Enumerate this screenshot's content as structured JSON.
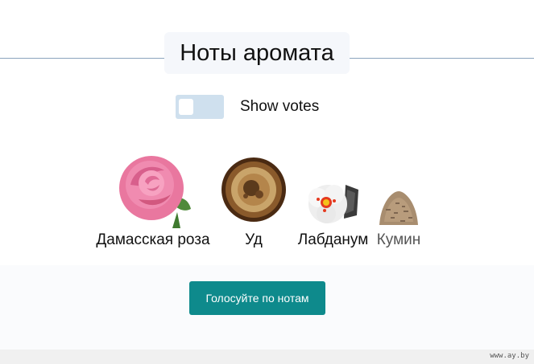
{
  "section": {
    "title": "Ноты аромата"
  },
  "toggle": {
    "label": "Show votes",
    "on": false
  },
  "notes": [
    {
      "name": "Дамасская роза",
      "icon": "rose-image"
    },
    {
      "name": "Уд",
      "icon": "oud-wood-image"
    },
    {
      "name": "Лабданум",
      "icon": "labdanum-flower-image"
    },
    {
      "name": "Кумин",
      "icon": "cumin-seeds-image"
    }
  ],
  "vote_button": {
    "label": "Голосуйте по нотам"
  },
  "watermark": {
    "text": "www.ay.by"
  },
  "colors": {
    "accent": "#0e8a8c",
    "toggle_bg": "#cfe0ee",
    "rule": "#8ba3bd"
  }
}
